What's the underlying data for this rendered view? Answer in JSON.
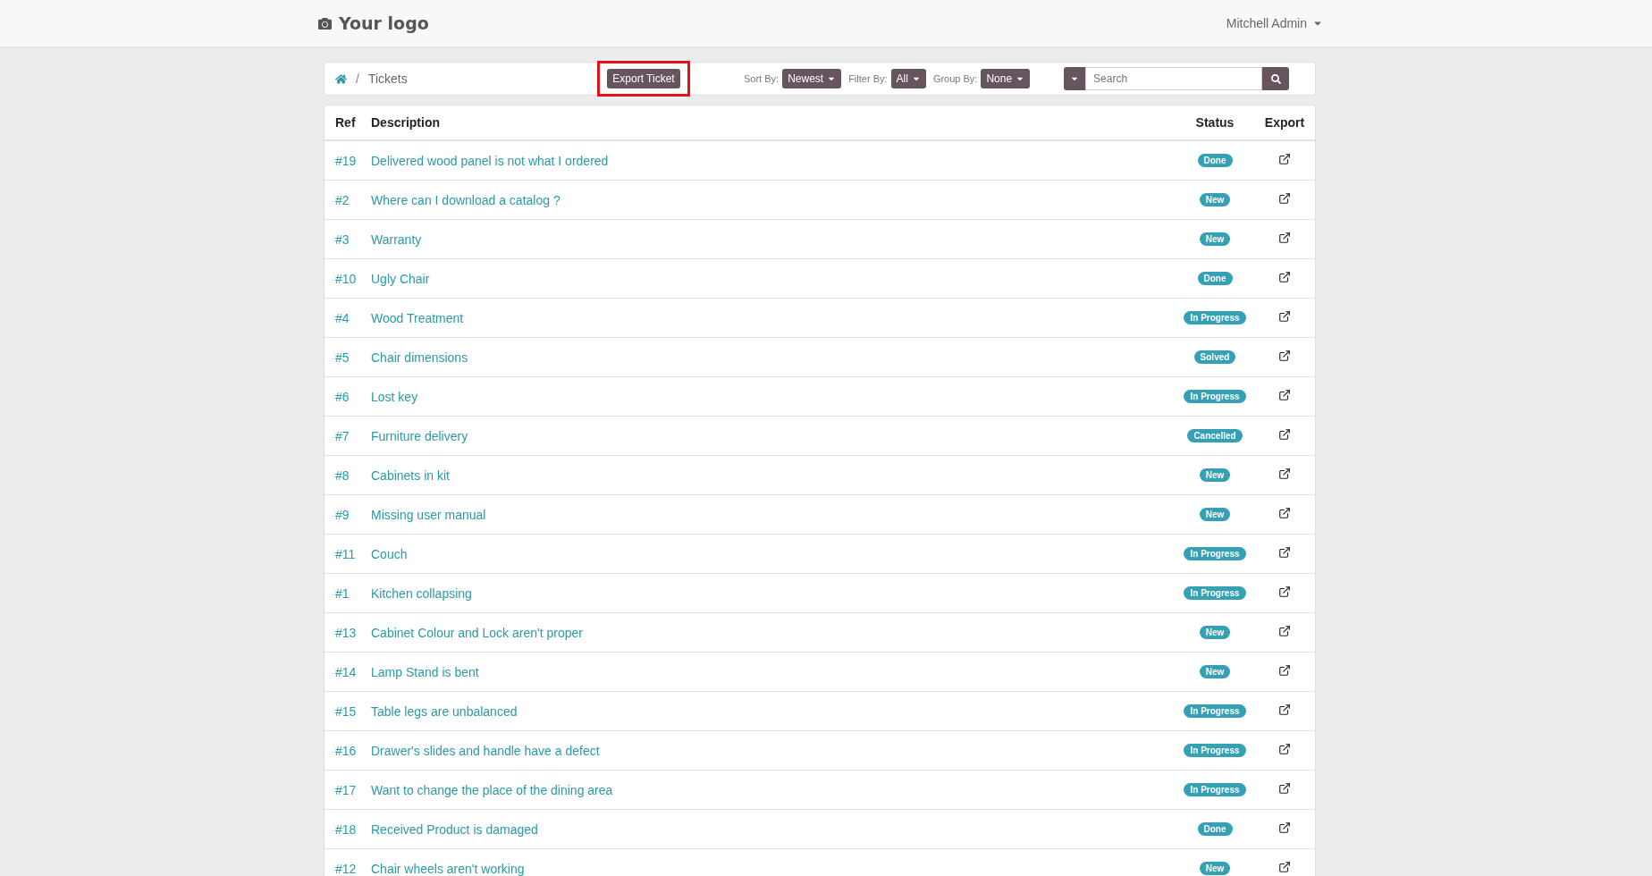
{
  "header": {
    "logo": "Your logo",
    "user": "Mitchell Admin"
  },
  "breadcrumb": {
    "separator": "/",
    "current": "Tickets"
  },
  "export_button": {
    "label": "Export Ticket",
    "highlighted": true
  },
  "filters": [
    {
      "label": "Sort By:",
      "value": "Newest"
    },
    {
      "label": "Filter By:",
      "value": "All"
    },
    {
      "label": "Group By:",
      "value": "None"
    }
  ],
  "search": {
    "placeholder": "Search"
  },
  "table": {
    "columns": [
      "Ref",
      "Description",
      "Status",
      "Export"
    ],
    "rows": [
      {
        "ref": "#19",
        "description": "Delivered wood panel is not what I ordered",
        "status": "Done"
      },
      {
        "ref": "#2",
        "description": "Where can I download a catalog ?",
        "status": "New"
      },
      {
        "ref": "#3",
        "description": "Warranty",
        "status": "New"
      },
      {
        "ref": "#10",
        "description": "Ugly Chair",
        "status": "Done"
      },
      {
        "ref": "#4",
        "description": "Wood Treatment",
        "status": "In Progress"
      },
      {
        "ref": "#5",
        "description": "Chair dimensions",
        "status": "Solved"
      },
      {
        "ref": "#6",
        "description": "Lost key",
        "status": "In Progress"
      },
      {
        "ref": "#7",
        "description": "Furniture delivery",
        "status": "Cancelled"
      },
      {
        "ref": "#8",
        "description": "Cabinets in kit",
        "status": "New"
      },
      {
        "ref": "#9",
        "description": "Missing user manual",
        "status": "New"
      },
      {
        "ref": "#11",
        "description": "Couch",
        "status": "In Progress"
      },
      {
        "ref": "#1",
        "description": "Kitchen collapsing",
        "status": "In Progress"
      },
      {
        "ref": "#13",
        "description": "Cabinet Colour and Lock aren't proper",
        "status": "New"
      },
      {
        "ref": "#14",
        "description": "Lamp Stand is bent",
        "status": "New"
      },
      {
        "ref": "#15",
        "description": "Table legs are unbalanced",
        "status": "In Progress"
      },
      {
        "ref": "#16",
        "description": "Drawer's slides and handle have a defect",
        "status": "In Progress"
      },
      {
        "ref": "#17",
        "description": "Want to change the place of the dining area",
        "status": "In Progress"
      },
      {
        "ref": "#18",
        "description": "Received Product is damaged",
        "status": "Done"
      },
      {
        "ref": "#12",
        "description": "Chair wheels aren't working",
        "status": "New"
      }
    ]
  }
}
